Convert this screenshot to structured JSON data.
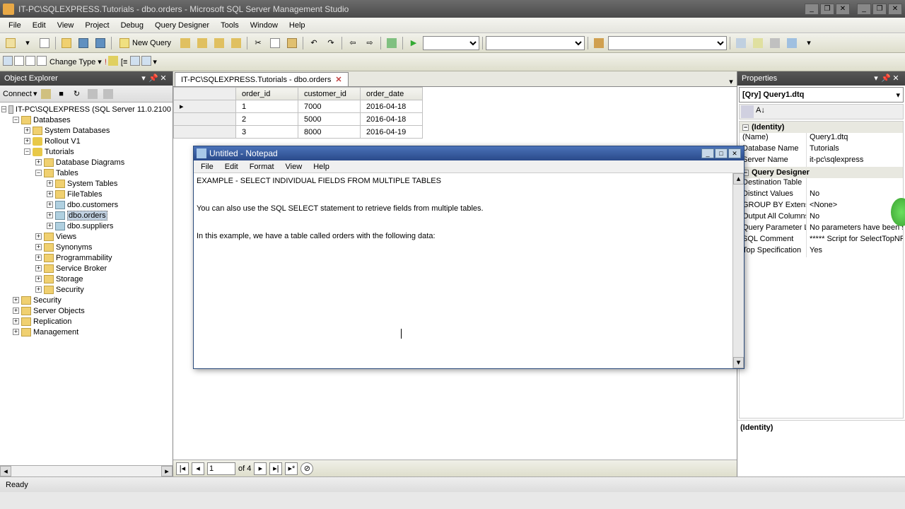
{
  "window": {
    "title": "IT-PC\\SQLEXPRESS.Tutorials - dbo.orders - Microsoft SQL Server Management Studio"
  },
  "menubar": {
    "items": [
      "File",
      "Edit",
      "View",
      "Project",
      "Debug",
      "Query Designer",
      "Tools",
      "Window",
      "Help"
    ]
  },
  "toolbar": {
    "new_query": "New Query",
    "change_type": "Change Type"
  },
  "object_explorer": {
    "title": "Object Explorer",
    "connect": "Connect",
    "root": "IT-PC\\SQLEXPRESS (SQL Server 11.0.2100",
    "nodes": {
      "databases": "Databases",
      "system_databases": "System Databases",
      "rollout": "Rollout V1",
      "tutorials": "Tutorials",
      "db_diagrams": "Database Diagrams",
      "tables": "Tables",
      "system_tables": "System Tables",
      "file_tables": "FileTables",
      "customers": "dbo.customers",
      "orders": "dbo.orders",
      "suppliers": "dbo.suppliers",
      "views": "Views",
      "synonyms": "Synonyms",
      "programmability": "Programmability",
      "service_broker": "Service Broker",
      "storage": "Storage",
      "security_db": "Security",
      "security": "Security",
      "server_objects": "Server Objects",
      "replication": "Replication",
      "management": "Management"
    }
  },
  "doc_tab": {
    "label": "IT-PC\\SQLEXPRESS.Tutorials - dbo.orders"
  },
  "grid": {
    "columns": [
      "order_id",
      "customer_id",
      "order_date"
    ],
    "rows": [
      [
        "1",
        "7000",
        "2016-04-18"
      ],
      [
        "2",
        "5000",
        "2016-04-18"
      ],
      [
        "3",
        "8000",
        "2016-04-19"
      ]
    ]
  },
  "nav": {
    "current": "1",
    "total": "of 4"
  },
  "properties": {
    "title": "Properties",
    "selector": "[Qry] Query1.dtq",
    "cat_identity": "(Identity)",
    "cat_designer": "Query Designer",
    "rows": {
      "name_k": "(Name)",
      "name_v": "Query1.dtq",
      "db_k": "Database Name",
      "db_v": "Tutorials",
      "server_k": "Server Name",
      "server_v": "it-pc\\sqlexpress",
      "dest_k": "Destination Table",
      "dest_v": "",
      "distinct_k": "Distinct Values",
      "distinct_v": "No",
      "groupby_k": "GROUP BY Extensi",
      "groupby_v": "<None>",
      "outall_k": "Output All Columns",
      "outall_v": "No",
      "qparam_k": "Query Parameter L",
      "qparam_v": "No parameters have been sp",
      "sqlcom_k": "SQL Comment",
      "sqlcom_v": "***** Script for SelectTopNR",
      "topspec_k": "Top Specification",
      "topspec_v": "Yes"
    },
    "desc_title": "(Identity)"
  },
  "status": {
    "ready": "Ready"
  },
  "notepad": {
    "title": "Untitled - Notepad",
    "menu": [
      "File",
      "Edit",
      "Format",
      "View",
      "Help"
    ],
    "line1": "EXAMPLE - SELECT INDIVIDUAL FIELDS FROM MULTIPLE TABLES",
    "line2": "You can also use the SQL SELECT statement to retrieve fields from multiple tables.",
    "line3": "In this example, we have a table called orders with the following data:"
  }
}
